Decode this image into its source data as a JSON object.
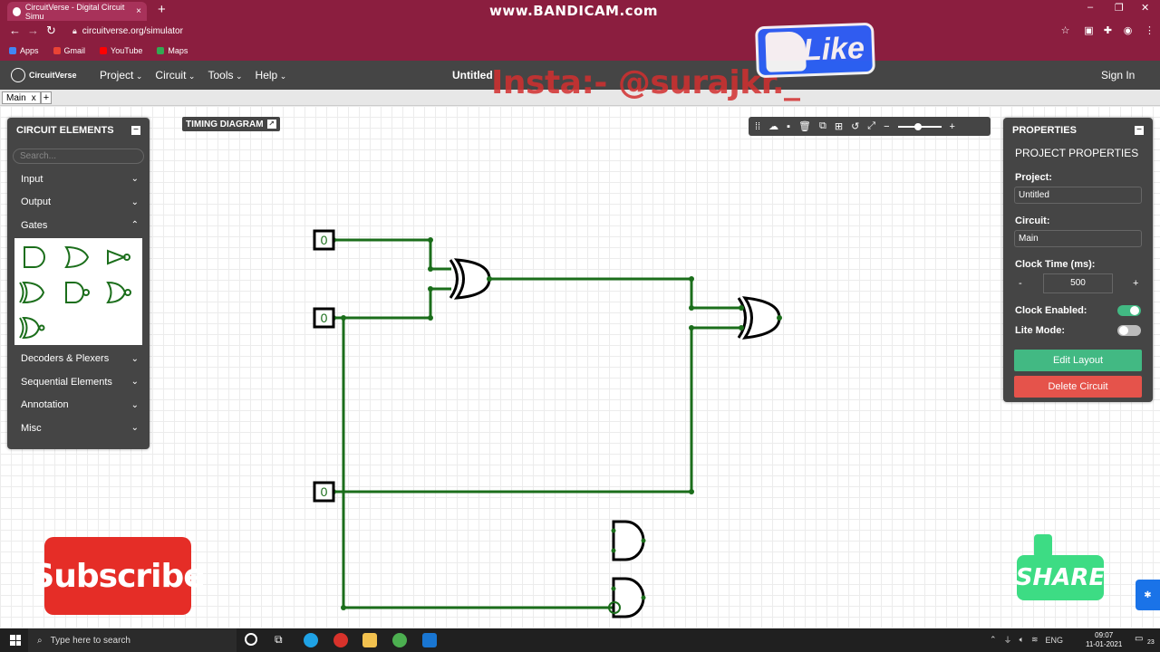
{
  "browser": {
    "tab_title": "CircuitVerse - Digital Circuit Simu",
    "tab_close": "×",
    "new_tab": "+",
    "recorder_watermark": "www.BANDICAM.com",
    "url": "circuitverse.org/simulator",
    "bookmarks": [
      {
        "label": "Apps",
        "color": "#4285f4"
      },
      {
        "label": "Gmail",
        "color": "#ea4335"
      },
      {
        "label": "YouTube",
        "color": "#ff0000"
      },
      {
        "label": "Maps",
        "color": "#34a853"
      }
    ]
  },
  "app": {
    "brand": "CircuitVerse",
    "menu": [
      "Project",
      "Circuit",
      "Tools",
      "Help"
    ],
    "project_title": "Untitled",
    "sign_in": "Sign In",
    "circuit_tab": "Main",
    "circuit_tab_close": "x",
    "add_tab": "+"
  },
  "elements_panel": {
    "title": "CIRCUIT ELEMENTS",
    "search_placeholder": "Search...",
    "categories_top": [
      "Input",
      "Output",
      "Gates"
    ],
    "gates": [
      "AND",
      "OR",
      "NOT",
      "XOR",
      "NAND",
      "NOR",
      "XNOR"
    ],
    "categories_bottom": [
      "Decoders & Plexers",
      "Sequential Elements",
      "Annotation",
      "Misc"
    ]
  },
  "timing_diagram": {
    "label": "TIMING DIAGRAM"
  },
  "canvas": {
    "input_values": [
      "0",
      "0",
      "0"
    ],
    "wire_color": "#1b6e1b"
  },
  "properties_panel": {
    "title": "PROPERTIES",
    "subtitle": "PROJECT PROPERTIES",
    "project_label": "Project:",
    "project_value": "Untitled",
    "circuit_label": "Circuit:",
    "circuit_value": "Main",
    "clock_label": "Clock Time (ms):",
    "clock_minus": "-",
    "clock_value": "500",
    "clock_plus": "+",
    "clock_enabled_label": "Clock Enabled:",
    "clock_enabled": true,
    "lite_mode_label": "Lite Mode:",
    "lite_mode": false,
    "edit_layout": "Edit Layout",
    "delete_circuit": "Delete Circuit",
    "colors": {
      "edit": "#42b983",
      "delete": "#e5534b",
      "toggle_on": "#42b983",
      "toggle_off": "#bbbbbb"
    }
  },
  "overlays": {
    "insta_text": "Insta:- @surajkr._",
    "like": "Like",
    "subscribe": "Subscribe",
    "share": "SHARE"
  },
  "taskbar": {
    "search_placeholder": "Type here to search",
    "lang": "ENG",
    "time": "09:07",
    "date": "11-01-2021",
    "notifications": "23"
  }
}
